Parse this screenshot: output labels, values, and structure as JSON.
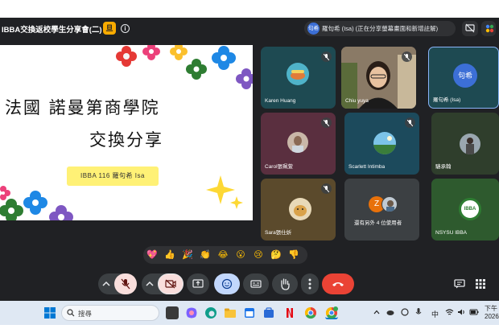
{
  "colors": {
    "meet_bg": "#202124",
    "tile_bg": "#303134",
    "end_call": "#ea4335",
    "mic_off_btn": "#f9dedc",
    "active_btn": "#c2d7fc",
    "taskbar": "#dfe8f3"
  },
  "topbar": {
    "meeting_title": "IBBA交換返校學生分享會(二)",
    "title_badge": "旦",
    "info_icon": "info-icon",
    "presenter_avatar": "句希",
    "presenting_text": "羅句希 (Isa) (正在分享螢幕畫面和新增註解)"
  },
  "slide": {
    "title": "法國 諾曼第商學院",
    "subtitle": "交換分享",
    "presenter_line": "IBBA 116 羅句希 Isa"
  },
  "participants": [
    {
      "name": "Karen Huang",
      "mic_muted": true
    },
    {
      "name": "Chiu yuya",
      "mic_muted": true
    },
    {
      "name": "羅句希 (Isa)",
      "avatar": "句希",
      "mic_muted": false
    },
    {
      "name": "Carol張珮萱",
      "mic_muted": true
    },
    {
      "name": "Scarlett Intimba",
      "mic_muted": true
    },
    {
      "name": "駱承翰",
      "mic_muted": false
    },
    {
      "name": "Sara張仕妡",
      "mic_muted": true
    },
    {
      "name": "還有另外 4 位使用者",
      "extra_letter": "Z",
      "mic_muted": false
    },
    {
      "name": "NSYSU IBBA",
      "logo_text": "IBBA",
      "mic_muted": false
    }
  ],
  "reactions": [
    "💖",
    "👍",
    "🎉",
    "👏",
    "😂",
    "😮",
    "😢",
    "🤔",
    "👎"
  ],
  "controls": {
    "end_call_icon": "phone-hangup-icon",
    "chat_icon": "chat-icon",
    "activities_icon": "grid-icon"
  },
  "taskbar": {
    "search_placeholder": "搜尋",
    "ime_label": "中",
    "clock_time": "下午",
    "clock_date": "2026/"
  }
}
